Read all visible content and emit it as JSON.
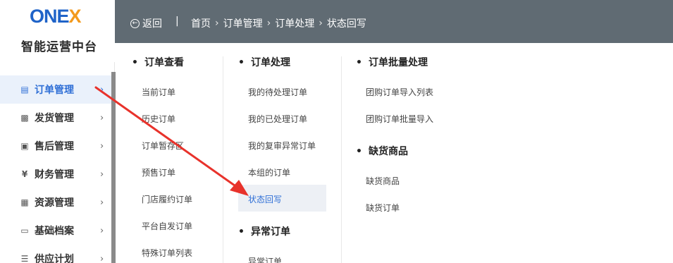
{
  "logo": {
    "brand_main": "ONE",
    "brand_x": "X",
    "subtitle": "智能运营中台"
  },
  "header": {
    "back_label": "返回",
    "separator": "|",
    "breadcrumbs": [
      "首页",
      "订单管理",
      "订单处理",
      "状态回写"
    ],
    "arrow": "›"
  },
  "sidebar": {
    "items": [
      {
        "label": "订单管理",
        "icon": "document-icon",
        "active": true
      },
      {
        "label": "发货管理",
        "icon": "truck-icon",
        "active": false
      },
      {
        "label": "售后管理",
        "icon": "service-icon",
        "active": false
      },
      {
        "label": "财务管理",
        "icon": "yen-icon",
        "active": false
      },
      {
        "label": "资源管理",
        "icon": "box-icon",
        "active": false
      },
      {
        "label": "基础档案",
        "icon": "archive-icon",
        "active": false
      },
      {
        "label": "供应计划",
        "icon": "plan-icon",
        "active": false
      }
    ],
    "chevron": "›"
  },
  "menu": {
    "col1": {
      "title": "订单查看",
      "links": [
        "当前订单",
        "历史订单",
        "订单暂存区",
        "预售订单",
        "门店履约订单",
        "平台自发订单",
        "特殊订单列表"
      ]
    },
    "col2": {
      "title": "订单处理",
      "links": [
        "我的待处理订单",
        "我的已处理订单",
        "我的复审异常订单",
        "本组的订单",
        "状态回写"
      ],
      "title2": "异常订单",
      "links2": [
        "异常订单"
      ]
    },
    "col3": {
      "title": "订单批量处理",
      "links": [
        "团购订单导入列表",
        "团购订单批量导入"
      ],
      "title2": "缺货商品",
      "links2": [
        "缺货商品",
        "缺货订单"
      ]
    }
  },
  "colors": {
    "accent": "#2f6fd6",
    "header_bg": "#606b73",
    "arrow": "#e8322b",
    "logo_orange": "#f39a1e"
  }
}
